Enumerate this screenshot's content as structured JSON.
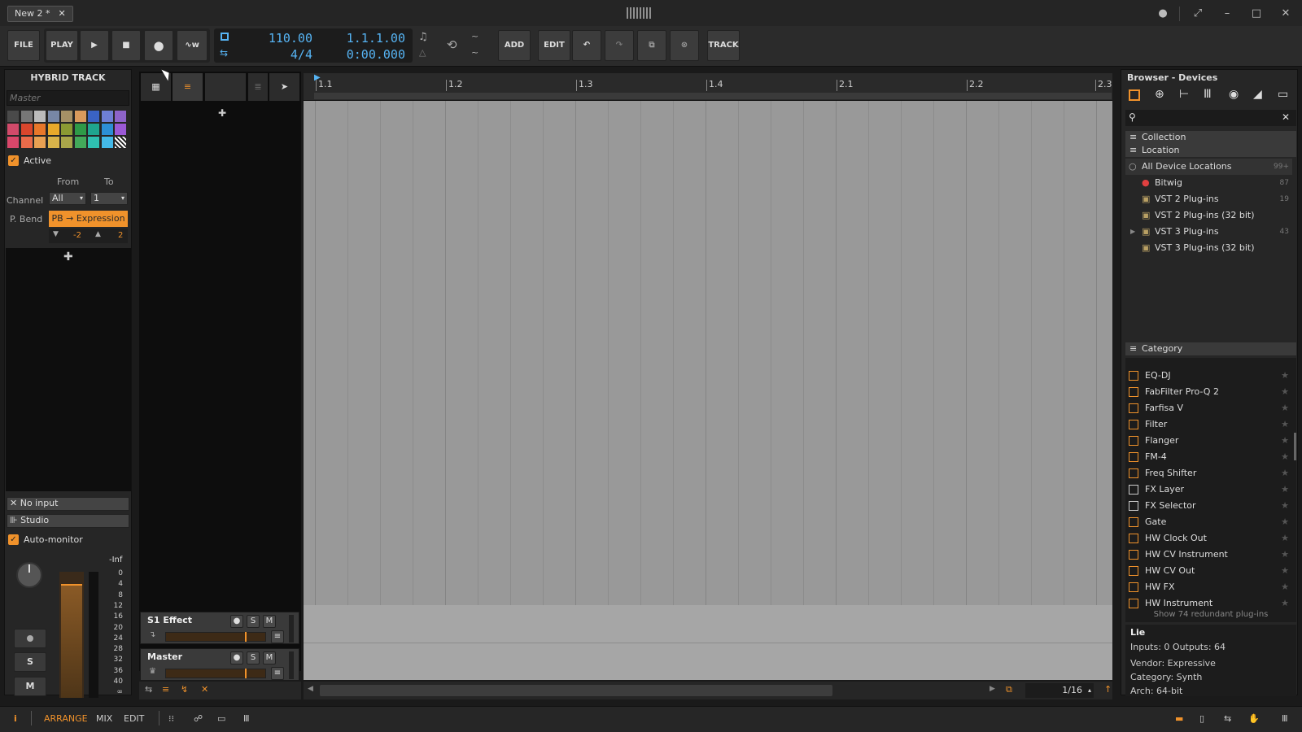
{
  "window": {
    "doc_tab": "New 2 *",
    "close_glyph": "✕"
  },
  "toolbar": {
    "file": "FILE",
    "play_label": "PLAY",
    "tempo": "110.00",
    "signature": "4/4",
    "position_bars": "1.1.1.00",
    "position_time": "0:00.000",
    "add": "ADD",
    "edit": "EDIT",
    "track": "TRACK"
  },
  "inspector": {
    "title": "HYBRID TRACK",
    "name_placeholder": "Master",
    "active_label": "Active",
    "from_label": "From",
    "to_label": "To",
    "channel_label": "Channel",
    "channel_from": "All",
    "channel_to": "1",
    "pbend_label": "P. Bend",
    "pbend_value": "PB → Expression",
    "pb_down": "-2",
    "pb_up": "2",
    "input": "No input",
    "output": "Studio",
    "automonitor_label": "Auto-monitor",
    "meter_inf": "-Inf",
    "meter_scale": [
      "0",
      "4",
      "8",
      "12",
      "16",
      "20",
      "24",
      "28",
      "32",
      "36",
      "40",
      "∞"
    ],
    "btn_s": "S",
    "btn_m": "M",
    "palette": [
      "#4a4a4a",
      "#777777",
      "#bbbbbb",
      "#7787a6",
      "#a59166",
      "#d99a5c",
      "#3a63c4",
      "#6e7fd6",
      "#8d63c9",
      "#d24a6a",
      "#d9462c",
      "#e8772a",
      "#e8a92a",
      "#8b9a33",
      "#2e9a47",
      "#1fa58f",
      "#2c8fd6",
      "#9b59d6",
      "#d9476a",
      "#ea6b4a",
      "#e8a052",
      "#d8b34a",
      "#a9a64a",
      "#43a95a",
      "#2fbfb0",
      "#44b9e8"
    ]
  },
  "tracks": [
    {
      "name": "S1 Effect"
    },
    {
      "name": "Master"
    }
  ],
  "ruler": {
    "markers": [
      "1.1",
      "1.2",
      "1.3",
      "1.4",
      "2.1",
      "2.2",
      "2.3"
    ]
  },
  "browser": {
    "title": "Browser - Devices",
    "sections": {
      "collection": "Collection",
      "location": "Location",
      "category": "Category"
    },
    "locations": [
      {
        "name": "All Device Locations",
        "count": "99+"
      },
      {
        "name": "Bitwig",
        "count": "87"
      },
      {
        "name": "VST 2 Plug-ins",
        "count": "19"
      },
      {
        "name": "VST 2 Plug-ins (32 bit)",
        "count": ""
      },
      {
        "name": "VST 3 Plug-ins",
        "count": "43"
      },
      {
        "name": "VST 3 Plug-ins (32 bit)",
        "count": ""
      }
    ],
    "devices": [
      "EQ-DJ",
      "FabFilter Pro-Q 2",
      "Farfisa V",
      "Filter",
      "Flanger",
      "FM-4",
      "Freq Shifter",
      "FX Layer",
      "FX Selector",
      "Gate",
      "HW Clock Out",
      "HW CV Instrument",
      "HW CV Out",
      "HW FX",
      "HW Instrument"
    ],
    "redundant": "Show 74 redundant plug-ins",
    "info": {
      "name": "Lie",
      "io": "Inputs: 0   Outputs: 64",
      "vendor": "Vendor: Expressive",
      "category": "Category: Synth",
      "arch": "Arch: 64-bit"
    }
  },
  "arrange_footer": {
    "grid": "1/16"
  },
  "bottombar": {
    "arrange": "ARRANGE",
    "mix": "MIX",
    "edit": "EDIT"
  }
}
